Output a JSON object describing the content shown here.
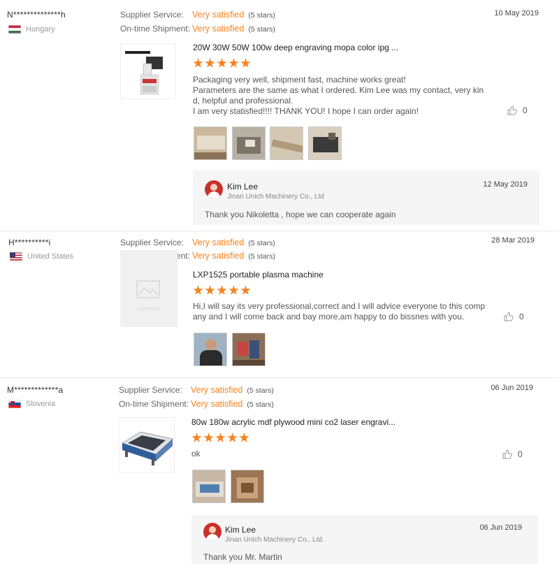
{
  "reviews": [
    {
      "buyer": "N**************h",
      "country": "Hungary",
      "supplier_service_label": "Supplier Service:",
      "supplier_service_value": "Very satisfied",
      "supplier_service_stars": "(5 stars)",
      "shipment_label": "On-time Shipment:",
      "shipment_value": "Very satisfied",
      "shipment_stars": "(5 stars)",
      "date": "10 May 2019",
      "product_title": "20W 30W 50W 100w deep engraving mopa color ipg ...",
      "rating": 5,
      "text_lines": [
        "Packaging very well, shipment fast, machine works great!",
        "Parameters are the same as what I ordered. Kim Lee was my contact, very kin",
        "d, helpful and professional.",
        "I am very statisfied!!!! THANK YOU! I hope I can order again!"
      ],
      "likes": "0",
      "reply": {
        "name": "Kim Lee",
        "company": "Jinan Unich Machinery Co., Ltd",
        "date": "12 May 2019",
        "text": "Thank you Nikoletta , hope we can cooperate again"
      }
    },
    {
      "buyer": "H**********i",
      "country": "United States",
      "supplier_service_label": "Supplier Service:",
      "supplier_service_value": "Very satisfied",
      "supplier_service_stars": "(5 stars)",
      "shipment_label": "On-time Shipment:",
      "shipment_value": "Very satisfied",
      "shipment_stars": "(5 stars)",
      "date": "28 Mar 2019",
      "product_title": "LXP1525 portable plasma machine",
      "rating": 5,
      "text_lines": [
        "Hi,I will say its very professional,correct and I will advice everyone to this comp",
        "any and I will come back and bay more,am happy to do bissnes with you."
      ],
      "likes": "0"
    },
    {
      "buyer": "M*************a",
      "country": "Slovenia",
      "supplier_service_label": "Supplier Service:",
      "supplier_service_value": "Very satisfied",
      "supplier_service_stars": "(5 stars)",
      "shipment_label": "On-time Shipment:",
      "shipment_value": "Very satisfied",
      "shipment_stars": "(5 stars)",
      "date": "06 Jun 2019",
      "product_title": "80w 180w acrylic mdf plywood mini co2 laser engravi...",
      "rating": 5,
      "text_lines": [
        "ok"
      ],
      "likes": "0",
      "reply": {
        "name": "Kim Lee",
        "company": "Jinan Unich Machinery Co., Ltd.",
        "date": "06 Jun 2019",
        "text": "Thank you Mr. Martin"
      }
    }
  ],
  "colors": {
    "accent": "#f5821f",
    "reply_bg": "#f5f5f5"
  },
  "icons": {
    "like": "thumbs-up-icon"
  }
}
